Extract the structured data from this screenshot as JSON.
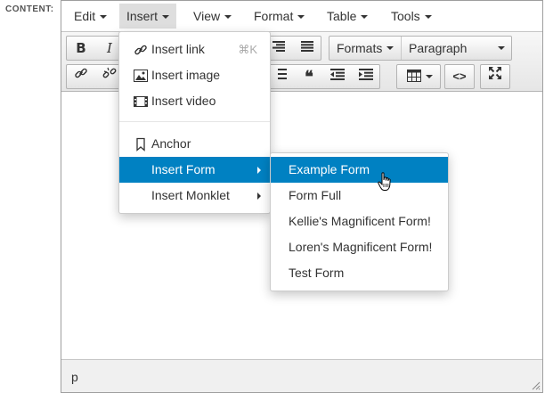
{
  "field_label": "CONTENT:",
  "menubar": {
    "items": [
      {
        "label": "Edit"
      },
      {
        "label": "Insert"
      },
      {
        "label": "View"
      },
      {
        "label": "Format"
      },
      {
        "label": "Table"
      },
      {
        "label": "Tools"
      }
    ],
    "active": "Insert"
  },
  "toolbar": {
    "formats_label": "Formats",
    "paragraph_label": "Paragraph"
  },
  "statusbar": {
    "path": "p"
  },
  "insert_menu": {
    "items": [
      {
        "label": "Insert link",
        "icon": "link-icon",
        "shortcut": "⌘K"
      },
      {
        "label": "Insert image",
        "icon": "image-icon"
      },
      {
        "label": "Insert video",
        "icon": "video-icon"
      },
      {
        "label": "Anchor",
        "icon": "bookmark-icon"
      },
      {
        "label": "Insert Form",
        "highlighted": true,
        "has_submenu": true
      },
      {
        "label": "Insert Monklet",
        "has_submenu": true
      }
    ]
  },
  "insert_form_submenu": {
    "items": [
      {
        "label": "Example Form",
        "highlighted": true
      },
      {
        "label": "Form Full"
      },
      {
        "label": "Kellie's Magnificent Form!"
      },
      {
        "label": "Loren's Magnificent Form!"
      },
      {
        "label": "Test Form"
      }
    ]
  },
  "colors": {
    "highlight": "#0081c2",
    "menu_active_bg": "#dedede",
    "toolbar_gradient_top": "#f7f7f7",
    "toolbar_gradient_bottom": "#e6e6e6"
  }
}
